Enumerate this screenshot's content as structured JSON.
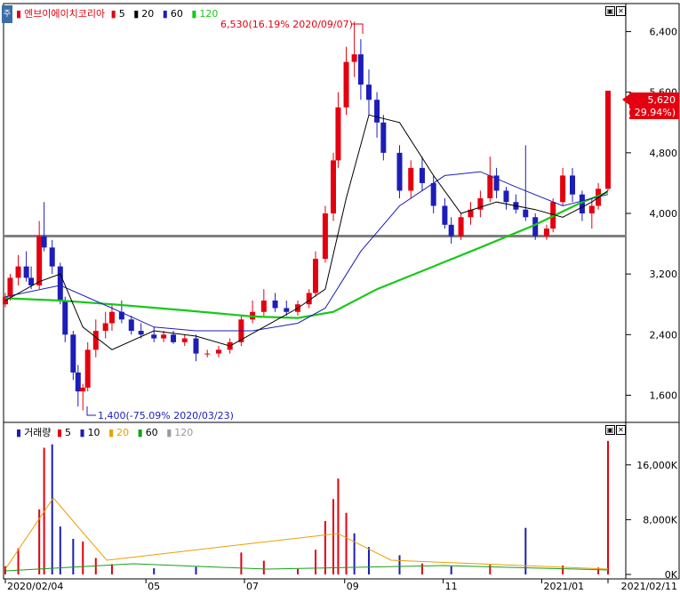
{
  "side_tab": "주",
  "price_pane": {
    "legend": {
      "name": "엔브이에이치코리아",
      "ma_labels": [
        "5",
        "20",
        "60",
        "120"
      ],
      "ma_colors": [
        "#e4000f",
        "#000000",
        "#1d1db8",
        "#19c819"
      ]
    },
    "y_axis_ticks": [
      "6,400",
      "5,600",
      "4,800",
      "4,000",
      "3,200",
      "2,400",
      "1,600"
    ],
    "y_axis_values": [
      6400,
      5600,
      4800,
      4000,
      3200,
      2400,
      1600
    ],
    "high_annotation": "6,530(16.19% 2020/09/07)",
    "low_annotation": "1,400(-75.09% 2020/03/23)",
    "current_price": "5,620",
    "current_change": "( 29.94%)",
    "reference_line": 3700,
    "buttons": [
      "▣",
      "✕"
    ]
  },
  "volume_pane": {
    "legend": {
      "name": "거래량",
      "ma_labels": [
        "5",
        "10",
        "20",
        "60",
        "120"
      ],
      "ma_colors": [
        "#e4000f",
        "#1d1db8",
        "#e8a000",
        "#19a019",
        "#999999"
      ]
    },
    "y_axis_ticks": [
      "16,000K",
      "8,000K",
      "0K"
    ],
    "buttons": [
      "▣",
      "✕"
    ]
  },
  "x_axis_ticks": [
    "2020/02/04",
    "05",
    "07",
    "09",
    "11",
    "2021/01",
    "2021/02/11"
  ],
  "colors": {
    "up": "#e4000f",
    "down": "#1d1db8",
    "ma20": "#000000",
    "ma60": "#1d1db8",
    "ma120": "#19c819",
    "reference": "#808080"
  },
  "chart_data": {
    "type": "candlestick",
    "period": "2020/02/04 - 2021/02/11",
    "ylim": [
      1300,
      6700
    ],
    "candles": [
      [
        "2020-02-04",
        2800,
        2950,
        2760,
        2900
      ],
      [
        "2020-02-07",
        2900,
        3200,
        2850,
        3150
      ],
      [
        "2020-02-12",
        3150,
        3450,
        3050,
        3300
      ],
      [
        "2020-02-17",
        3300,
        3500,
        3100,
        3150
      ],
      [
        "2020-02-20",
        3150,
        3300,
        3000,
        3050
      ],
      [
        "2020-02-25",
        3050,
        3900,
        3000,
        3700
      ],
      [
        "2020-02-28",
        3700,
        4150,
        3500,
        3550
      ],
      [
        "2020-03-04",
        3550,
        3650,
        3200,
        3300
      ],
      [
        "2020-03-09",
        3300,
        3350,
        2800,
        2850
      ],
      [
        "2020-03-12",
        2850,
        2900,
        2300,
        2400
      ],
      [
        "2020-03-17",
        2400,
        2450,
        1800,
        1900
      ],
      [
        "2020-03-20",
        1900,
        2000,
        1450,
        1650
      ],
      [
        "2020-03-23",
        1650,
        1750,
        1400,
        1700
      ],
      [
        "2020-03-26",
        1700,
        2300,
        1650,
        2200
      ],
      [
        "2020-03-31",
        2200,
        2600,
        2100,
        2450
      ],
      [
        "2020-04-06",
        2450,
        2700,
        2350,
        2550
      ],
      [
        "2020-04-10",
        2550,
        2800,
        2450,
        2700
      ],
      [
        "2020-04-16",
        2700,
        2850,
        2550,
        2600
      ],
      [
        "2020-04-22",
        2600,
        2650,
        2400,
        2450
      ],
      [
        "2020-04-28",
        2450,
        2550,
        2350,
        2400
      ],
      [
        "2020-05-06",
        2400,
        2500,
        2300,
        2350
      ],
      [
        "2020-05-12",
        2350,
        2450,
        2300,
        2400
      ],
      [
        "2020-05-18",
        2400,
        2450,
        2280,
        2300
      ],
      [
        "2020-05-25",
        2300,
        2400,
        2250,
        2350
      ],
      [
        "2020-06-01",
        2350,
        2400,
        2050,
        2150
      ],
      [
        "2020-06-08",
        2150,
        2200,
        2100,
        2150
      ],
      [
        "2020-06-15",
        2150,
        2250,
        2100,
        2200
      ],
      [
        "2020-06-22",
        2200,
        2350,
        2150,
        2300
      ],
      [
        "2020-06-29",
        2300,
        2650,
        2250,
        2600
      ],
      [
        "2020-07-06",
        2600,
        2850,
        2550,
        2700
      ],
      [
        "2020-07-13",
        2700,
        3000,
        2650,
        2850
      ],
      [
        "2020-07-20",
        2850,
        2950,
        2700,
        2750
      ],
      [
        "2020-07-27",
        2750,
        2850,
        2650,
        2700
      ],
      [
        "2020-08-03",
        2700,
        2850,
        2650,
        2800
      ],
      [
        "2020-08-10",
        2800,
        3000,
        2750,
        2950
      ],
      [
        "2020-08-14",
        2950,
        3500,
        2900,
        3400
      ],
      [
        "2020-08-20",
        3400,
        4100,
        3350,
        4000
      ],
      [
        "2020-08-25",
        4000,
        4800,
        3900,
        4700
      ],
      [
        "2020-08-28",
        4700,
        5600,
        4600,
        5400
      ],
      [
        "2020-09-02",
        5400,
        6200,
        5300,
        6000
      ],
      [
        "2020-09-07",
        6000,
        6530,
        5800,
        6100
      ],
      [
        "2020-09-11",
        6100,
        6300,
        5500,
        5700
      ],
      [
        "2020-09-16",
        5700,
        5900,
        5300,
        5500
      ],
      [
        "2020-09-21",
        5500,
        5600,
        5000,
        5200
      ],
      [
        "2020-09-25",
        5200,
        5300,
        4700,
        4800
      ],
      [
        "2020-10-05",
        4800,
        4900,
        4200,
        4300
      ],
      [
        "2020-10-12",
        4300,
        4700,
        4200,
        4600
      ],
      [
        "2020-10-19",
        4600,
        4750,
        4300,
        4400
      ],
      [
        "2020-10-26",
        4400,
        4500,
        4000,
        4100
      ],
      [
        "2020-11-02",
        4100,
        4200,
        3800,
        3850
      ],
      [
        "2020-11-06",
        3850,
        3950,
        3600,
        3700
      ],
      [
        "2020-11-12",
        3700,
        4000,
        3650,
        3950
      ],
      [
        "2020-11-18",
        3950,
        4150,
        3850,
        4050
      ],
      [
        "2020-11-24",
        4050,
        4300,
        3950,
        4200
      ],
      [
        "2020-11-30",
        4200,
        4750,
        4150,
        4500
      ],
      [
        "2020-12-04",
        4500,
        4600,
        4200,
        4300
      ],
      [
        "2020-12-10",
        4300,
        4350,
        4050,
        4150
      ],
      [
        "2020-12-16",
        4150,
        4250,
        4000,
        4050
      ],
      [
        "2020-12-22",
        4050,
        4900,
        3900,
        3950
      ],
      [
        "2020-12-28",
        3950,
        4000,
        3650,
        3700
      ],
      [
        "2021-01-04",
        3700,
        3850,
        3650,
        3800
      ],
      [
        "2021-01-08",
        3800,
        4200,
        3750,
        4150
      ],
      [
        "2021-01-14",
        4150,
        4600,
        4100,
        4500
      ],
      [
        "2021-01-20",
        4500,
        4600,
        4150,
        4250
      ],
      [
        "2021-01-26",
        4250,
        4300,
        3900,
        4000
      ],
      [
        "2021-02-01",
        4000,
        4200,
        3800,
        4100
      ],
      [
        "2021-02-05",
        4100,
        4400,
        4050,
        4325
      ],
      [
        "2021-02-11",
        4325,
        5620,
        4300,
        5620
      ]
    ],
    "ma20": [
      [
        "2020-02-04",
        2850
      ],
      [
        "2020-02-25",
        3100
      ],
      [
        "2020-03-09",
        3200
      ],
      [
        "2020-03-23",
        2500
      ],
      [
        "2020-04-10",
        2200
      ],
      [
        "2020-05-06",
        2450
      ],
      [
        "2020-06-01",
        2380
      ],
      [
        "2020-06-22",
        2250
      ],
      [
        "2020-07-13",
        2500
      ],
      [
        "2020-08-03",
        2750
      ],
      [
        "2020-08-20",
        3000
      ],
      [
        "2020-09-02",
        4200
      ],
      [
        "2020-09-16",
        5300
      ],
      [
        "2020-10-05",
        5200
      ],
      [
        "2020-10-26",
        4500
      ],
      [
        "2020-11-12",
        4000
      ],
      [
        "2020-12-04",
        4150
      ],
      [
        "2020-12-28",
        4050
      ],
      [
        "2021-01-14",
        3950
      ],
      [
        "2021-02-01",
        4150
      ],
      [
        "2021-02-11",
        4300
      ]
    ],
    "ma60": [
      [
        "2020-02-04",
        2900
      ],
      [
        "2020-03-09",
        3050
      ],
      [
        "2020-04-10",
        2750
      ],
      [
        "2020-05-06",
        2500
      ],
      [
        "2020-06-01",
        2450
      ],
      [
        "2020-07-06",
        2450
      ],
      [
        "2020-08-03",
        2550
      ],
      [
        "2020-08-20",
        2750
      ],
      [
        "2020-09-11",
        3500
      ],
      [
        "2020-10-05",
        4100
      ],
      [
        "2020-11-02",
        4500
      ],
      [
        "2020-11-24",
        4550
      ],
      [
        "2020-12-16",
        4350
      ],
      [
        "2021-01-14",
        4100
      ],
      [
        "2021-02-11",
        4250
      ]
    ],
    "ma120": [
      [
        "2020-02-04",
        2880
      ],
      [
        "2020-03-09",
        2850
      ],
      [
        "2020-04-10",
        2800
      ],
      [
        "2020-05-25",
        2720
      ],
      [
        "2020-07-06",
        2640
      ],
      [
        "2020-08-03",
        2620
      ],
      [
        "2020-08-25",
        2700
      ],
      [
        "2020-09-21",
        3000
      ],
      [
        "2020-10-26",
        3300
      ],
      [
        "2020-11-24",
        3550
      ],
      [
        "2020-12-28",
        3850
      ],
      [
        "2021-01-26",
        4150
      ],
      [
        "2021-02-11",
        4280
      ]
    ],
    "volume": [
      [
        "2020-02-04",
        1200,
        "up"
      ],
      [
        "2020-02-12",
        3800,
        "up"
      ],
      [
        "2020-02-25",
        9500,
        "up"
      ],
      [
        "2020-02-28",
        18500,
        "up"
      ],
      [
        "2020-03-04",
        19000,
        "down"
      ],
      [
        "2020-03-09",
        7000,
        "down"
      ],
      [
        "2020-03-17",
        5200,
        "down"
      ],
      [
        "2020-03-23",
        4800,
        "up"
      ],
      [
        "2020-03-31",
        2400,
        "up"
      ],
      [
        "2020-04-10",
        1500,
        "up"
      ],
      [
        "2020-05-06",
        900,
        "down"
      ],
      [
        "2020-06-01",
        1100,
        "down"
      ],
      [
        "2020-06-29",
        3200,
        "up"
      ],
      [
        "2020-07-13",
        2000,
        "up"
      ],
      [
        "2020-08-03",
        800,
        "up"
      ],
      [
        "2020-08-14",
        3600,
        "up"
      ],
      [
        "2020-08-20",
        7800,
        "up"
      ],
      [
        "2020-08-25",
        11000,
        "up"
      ],
      [
        "2020-08-28",
        14000,
        "up"
      ],
      [
        "2020-09-02",
        9000,
        "up"
      ],
      [
        "2020-09-07",
        6000,
        "down"
      ],
      [
        "2020-09-16",
        4000,
        "down"
      ],
      [
        "2020-10-05",
        2800,
        "down"
      ],
      [
        "2020-10-19",
        1600,
        "up"
      ],
      [
        "2020-11-06",
        1200,
        "down"
      ],
      [
        "2020-11-30",
        1400,
        "up"
      ],
      [
        "2020-12-22",
        6800,
        "down"
      ],
      [
        "2021-01-14",
        1300,
        "up"
      ],
      [
        "2021-02-05",
        1000,
        "up"
      ],
      [
        "2021-02-11",
        19500,
        "up"
      ]
    ]
  }
}
